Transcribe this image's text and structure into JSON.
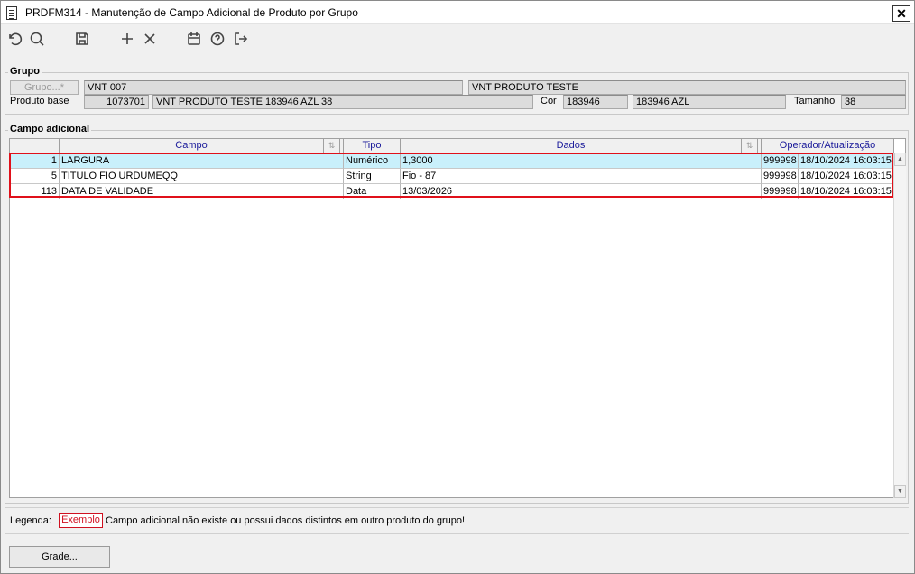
{
  "window": {
    "title": "PRDFM314 - Manutenção de Campo Adicional de Produto por Grupo",
    "close_glyph": "✕"
  },
  "toolbar": {
    "icons": [
      "undo-icon",
      "search-icon",
      "save-icon",
      "add-icon",
      "delete-icon",
      "calendar-icon",
      "help-icon",
      "exit-icon"
    ]
  },
  "grupo": {
    "legend": "Grupo",
    "button_label": "Grupo...*",
    "grupo_code": "VNT 007",
    "grupo_desc": "VNT PRODUTO TESTE",
    "produto_base_label": "Produto base",
    "produto_code": "1073701",
    "produto_desc": "VNT PRODUTO TESTE 183946 AZL 38",
    "cor_label": "Cor",
    "cor_code": "183946",
    "cor_desc": "183946 AZL",
    "tamanho_label": "Tamanho",
    "tamanho_value": "38"
  },
  "campo_adicional": {
    "legend": "Campo adicional",
    "columns": {
      "campo": "Campo",
      "tipo": "Tipo",
      "dados": "Dados",
      "operador": "Operador/Atualização"
    },
    "rows": [
      {
        "id": "1",
        "campo": "LARGURA",
        "tipo": "Numérico",
        "dados": "1,3000",
        "operador": "999998",
        "atualizacao": "18/10/2024 16:03:15"
      },
      {
        "id": "5",
        "campo": "TITULO FIO URDUMEQQ",
        "tipo": "String",
        "dados": "Fio - 87",
        "operador": "999998",
        "atualizacao": "18/10/2024 16:03:15"
      },
      {
        "id": "113",
        "campo": "DATA DE VALIDADE",
        "tipo": "Data",
        "dados": "13/03/2026",
        "operador": "999998",
        "atualizacao": "18/10/2024 16:03:15"
      }
    ]
  },
  "legenda": {
    "label": "Legenda:",
    "example": "Exemplo",
    "text": "Campo adicional não existe ou possui dados distintos em outro produto do grupo!"
  },
  "footer": {
    "grade_button": "Grade..."
  },
  "colors": {
    "highlight": "#e0101a",
    "selected_row": "#c9f0fb",
    "header_text": "#1a1a9a"
  }
}
